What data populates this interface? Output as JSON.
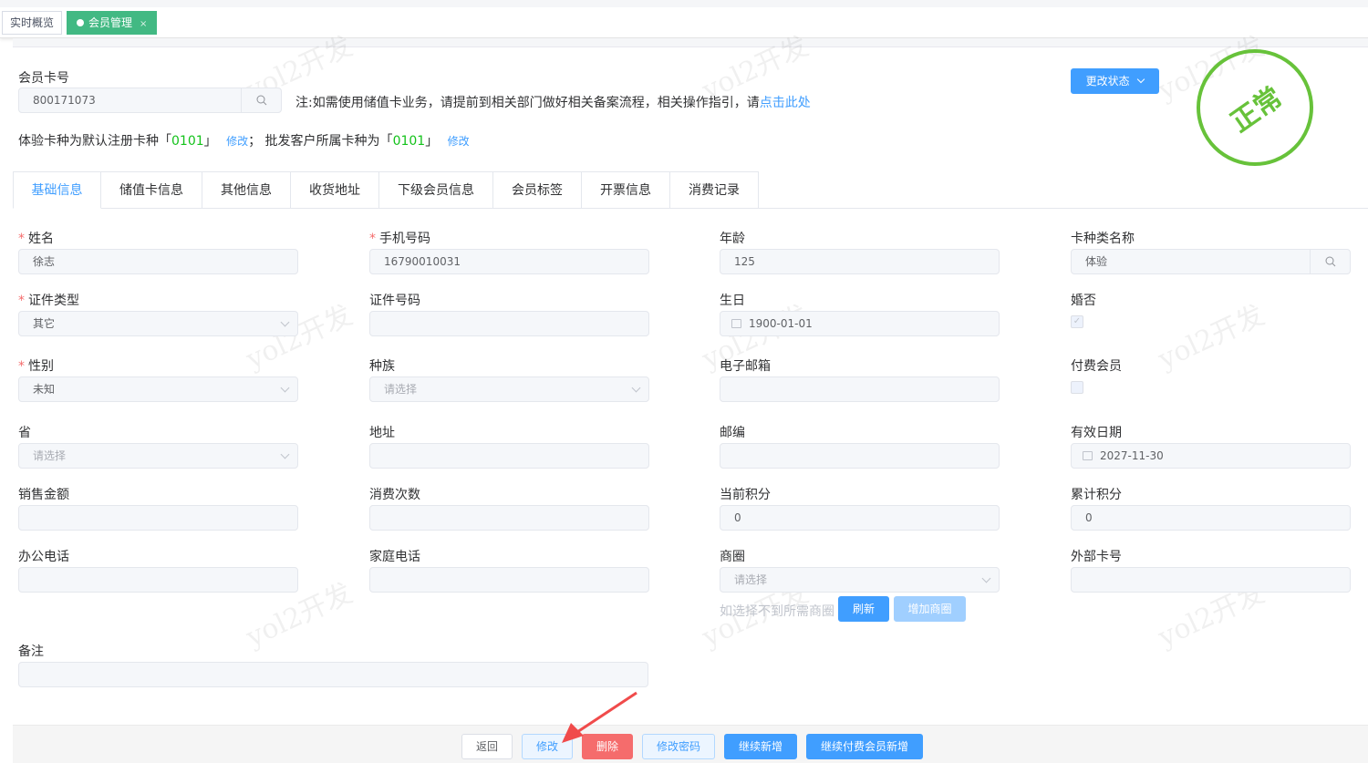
{
  "page_tabs": [
    {
      "label": "实时概览"
    },
    {
      "label": "会员管理",
      "close": "×"
    }
  ],
  "card": {
    "label": "会员卡号",
    "value": "800171073"
  },
  "note": {
    "text": "注:如需使用储值卡业务，请提前到相关部门做好相关备案流程，相关操作指引，请",
    "link": "点击此处"
  },
  "info": {
    "p1": "体验卡种为默认注册卡种「",
    "code1": "0101",
    "p2": "」",
    "edit1": "修改",
    "p3": "；  批发客户所属卡种为「",
    "code2": "0101",
    "p4": "」",
    "edit2": "修改"
  },
  "status_button": "更改状态",
  "stamp": "正常",
  "watermark": "yol2开发",
  "tabs": [
    "基础信息",
    "储值卡信息",
    "其他信息",
    "收货地址",
    "下级会员信息",
    "会员标签",
    "开票信息",
    "消费记录"
  ],
  "fields": [
    {
      "label": "姓名",
      "required": true,
      "type": "text",
      "value": "徐志"
    },
    {
      "label": "手机号码",
      "required": true,
      "type": "text",
      "value": "16790010031"
    },
    {
      "label": "年龄",
      "type": "text",
      "value": "125"
    },
    {
      "label": "卡种类名称",
      "type": "search",
      "value": "体验"
    },
    {
      "label": "证件类型",
      "required": true,
      "type": "select",
      "value": "其它"
    },
    {
      "label": "证件号码",
      "type": "text",
      "value": ""
    },
    {
      "label": "生日",
      "type": "date",
      "value": "1900-01-01"
    },
    {
      "label": "婚否",
      "type": "checkbox",
      "checked": true
    },
    {
      "label": "性别",
      "required": true,
      "type": "select",
      "value": "未知"
    },
    {
      "label": "种族",
      "type": "select",
      "placeholder": "请选择"
    },
    {
      "label": "电子邮箱",
      "type": "text",
      "value": ""
    },
    {
      "label": "付费会员",
      "type": "checkbox",
      "checked": false
    },
    {
      "label": "省",
      "type": "select",
      "placeholder": "请选择"
    },
    {
      "label": "地址",
      "type": "text",
      "value": ""
    },
    {
      "label": "邮编",
      "type": "text",
      "value": ""
    },
    {
      "label": "有效日期",
      "type": "date",
      "value": "2027-11-30"
    },
    {
      "label": "销售金额",
      "type": "text",
      "value": ""
    },
    {
      "label": "消费次数",
      "type": "text",
      "value": ""
    },
    {
      "label": "当前积分",
      "type": "text",
      "value": "0"
    },
    {
      "label": "累计积分",
      "type": "text",
      "value": "0"
    },
    {
      "label": "办公电话",
      "type": "text",
      "value": ""
    },
    {
      "label": "家庭电话",
      "type": "text",
      "value": ""
    },
    {
      "label": "商圈",
      "type": "select",
      "placeholder": "请选择"
    },
    {
      "label": "外部卡号",
      "type": "text",
      "value": ""
    }
  ],
  "circle_hint": "如选择不到所需商圈",
  "refresh": "刷新",
  "add_circle": "增加商圈",
  "remark": {
    "label": "备注",
    "value": ""
  },
  "footer": {
    "back": "返回",
    "edit": "修改",
    "delete": "删除",
    "change_password": "修改密码",
    "continue_add": "继续新增",
    "continue_paid_add": "继续付费会员新增"
  },
  "colors": {
    "primary": "#409eff",
    "tab_green": "#42b983",
    "stamp": "#67c23a",
    "danger": "#f56c6c"
  }
}
